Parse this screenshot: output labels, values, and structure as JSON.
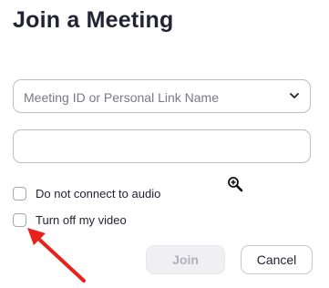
{
  "dialog": {
    "title": "Join a Meeting",
    "meeting_id_placeholder": "Meeting ID or Personal Link Name",
    "name_value": "",
    "options": [
      {
        "label": "Do not connect to audio",
        "checked": false
      },
      {
        "label": "Turn off my video",
        "checked": false
      }
    ],
    "join_label": "Join",
    "cancel_label": "Cancel"
  },
  "icons": {
    "dropdown": "chevron-down-icon",
    "cursor": "zoom-in-cursor-icon",
    "annotation": "red-arrow-icon"
  },
  "colors": {
    "text": "#232333",
    "placeholder": "#7a7a84",
    "border": "#bdbdc4",
    "join_disabled_bg": "#f0f0f4",
    "join_disabled_text": "#b0b0ba",
    "annotation": "#e8211b"
  }
}
